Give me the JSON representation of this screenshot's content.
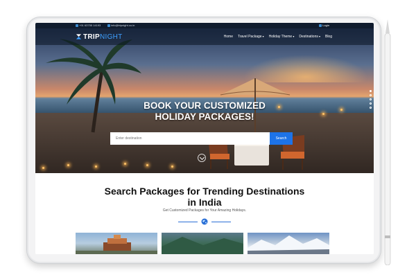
{
  "topbar": {
    "phone": "+91 63755 14193",
    "email": "info@tripnight.co.in",
    "login": "Login"
  },
  "logo": {
    "part1": "TRIP",
    "part2": "NIGHT"
  },
  "nav": {
    "items": [
      {
        "label": "Home",
        "dropdown": false
      },
      {
        "label": "Travel Package",
        "dropdown": true
      },
      {
        "label": "Holiday Theme",
        "dropdown": true
      },
      {
        "label": "Destinations",
        "dropdown": true
      },
      {
        "label": "Blog",
        "dropdown": false
      }
    ]
  },
  "hero": {
    "title_line1": "BOOK YOUR CUSTOMIZED",
    "title_line2": "HOLIDAY PACKAGES!",
    "search_placeholder": "Enter destination",
    "search_button": "Search",
    "slide_count": 5,
    "active_slide": 1
  },
  "section": {
    "title_line1": "Search Packages for Trending Destinations",
    "title_line2": "in India",
    "subtitle": "Get Customized Packages for Your Amazing Holidays."
  },
  "colors": {
    "accent": "#1d73e8",
    "topbar_bg": "#0f1b2d",
    "logo_accent": "#3ea0ff"
  },
  "icons": [
    "logo-mark-icon",
    "phone-icon",
    "mail-icon",
    "user-icon",
    "scroll-down-icon",
    "globe-icon"
  ]
}
